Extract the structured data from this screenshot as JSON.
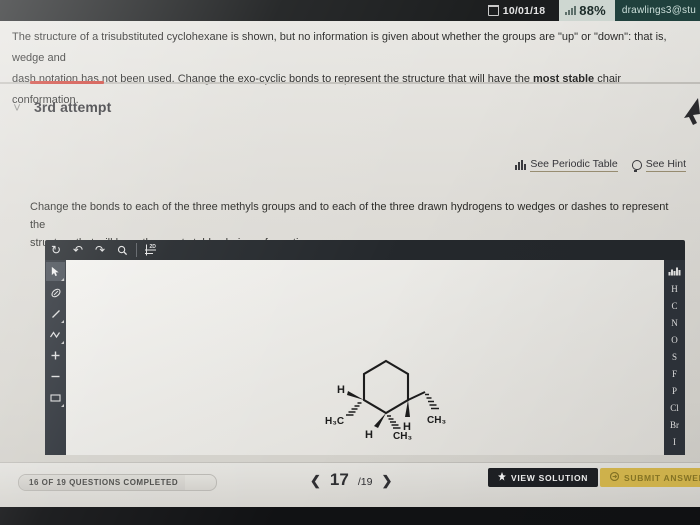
{
  "statusbar": {
    "date": "10/01/18",
    "date_icon": "calendar-icon",
    "battery_percent": "88%",
    "signal_icon": "signal-bars-icon",
    "user_email": "drawlings3@stu",
    "accent_teal": "#20423e",
    "pct_bg": "#cfd8d2"
  },
  "prose": {
    "line1_a": "The structure of a trisubstituted cyclohexane is shown, but no information is given about whether the groups are \"up\" or \"down\": that is, wedge and",
    "line2_a": "dash notation has not been used. Change the exo-cyclic bonds to represent the structure that will have the ",
    "line2_emph": "most stable",
    "line2_b": " chair conformation."
  },
  "attempt": {
    "chevron_icon": "chevron-down-icon",
    "title": "3rd attempt",
    "progress_color": "#d0493f",
    "cursor_icon": "mouse-cursor-arrow-icon"
  },
  "helpers": {
    "periodic_table": "See Periodic Table",
    "periodic_table_icon": "bar-chart-icon",
    "hint": "See Hint",
    "hint_icon": "lightbulb-icon"
  },
  "instruction": {
    "line1": "Change the bonds to each of the three methyls groups and to each of the three drawn hydrogens to wedges or dashes to represent the",
    "line2": "structure that will have the most stable chair conformation."
  },
  "editor": {
    "toolbar_top": [
      {
        "name": "reset-icon",
        "glyph": "↻"
      },
      {
        "name": "undo-icon",
        "glyph": "↶"
      },
      {
        "name": "redo-icon",
        "glyph": "↷"
      },
      {
        "name": "zoom-icon",
        "glyph": "⌕"
      },
      {
        "name": "measure-2d-icon",
        "glyph": "2D"
      }
    ],
    "toolbar_left": [
      {
        "name": "select-cursor-tool",
        "glyph": "➤",
        "selected": true
      },
      {
        "name": "eraser-tool",
        "glyph": "⌀",
        "selected": false
      },
      {
        "name": "single-bond-tool",
        "glyph": "╱",
        "selected": false
      },
      {
        "name": "chain-tool",
        "glyph": "⸺",
        "selected": false
      },
      {
        "name": "increase-charge-tool",
        "glyph": "+",
        "selected": false
      },
      {
        "name": "decrease-charge-tool",
        "glyph": "–",
        "selected": false
      },
      {
        "name": "template-ring-tool",
        "glyph": "▭",
        "selected": false
      }
    ],
    "element_palette_icon": "periodic-table-icon",
    "element_palette": [
      "H",
      "C",
      "N",
      "O",
      "S",
      "F",
      "P",
      "Cl",
      "Br",
      "I"
    ],
    "molecule": {
      "name": "trisubstituted-cyclohexane",
      "ring": "cyclohexane",
      "labels": [
        "H",
        "H₃C",
        "H",
        "CH₃",
        "H",
        "CH₃"
      ]
    }
  },
  "bottombar": {
    "questions_completed": "16 OF 19 QUESTIONS COMPLETED",
    "prev_icon": "chevron-left-icon",
    "page_current": "17",
    "page_total": "/19",
    "next_icon": "chevron-right-icon",
    "view_solution": "VIEW SOLUTION",
    "view_solution_icon": "key-icon",
    "submit_answer": "SUBMIT ANSWER",
    "submit_answer_icon": "send-icon",
    "submit_color": "#d6b84e"
  }
}
